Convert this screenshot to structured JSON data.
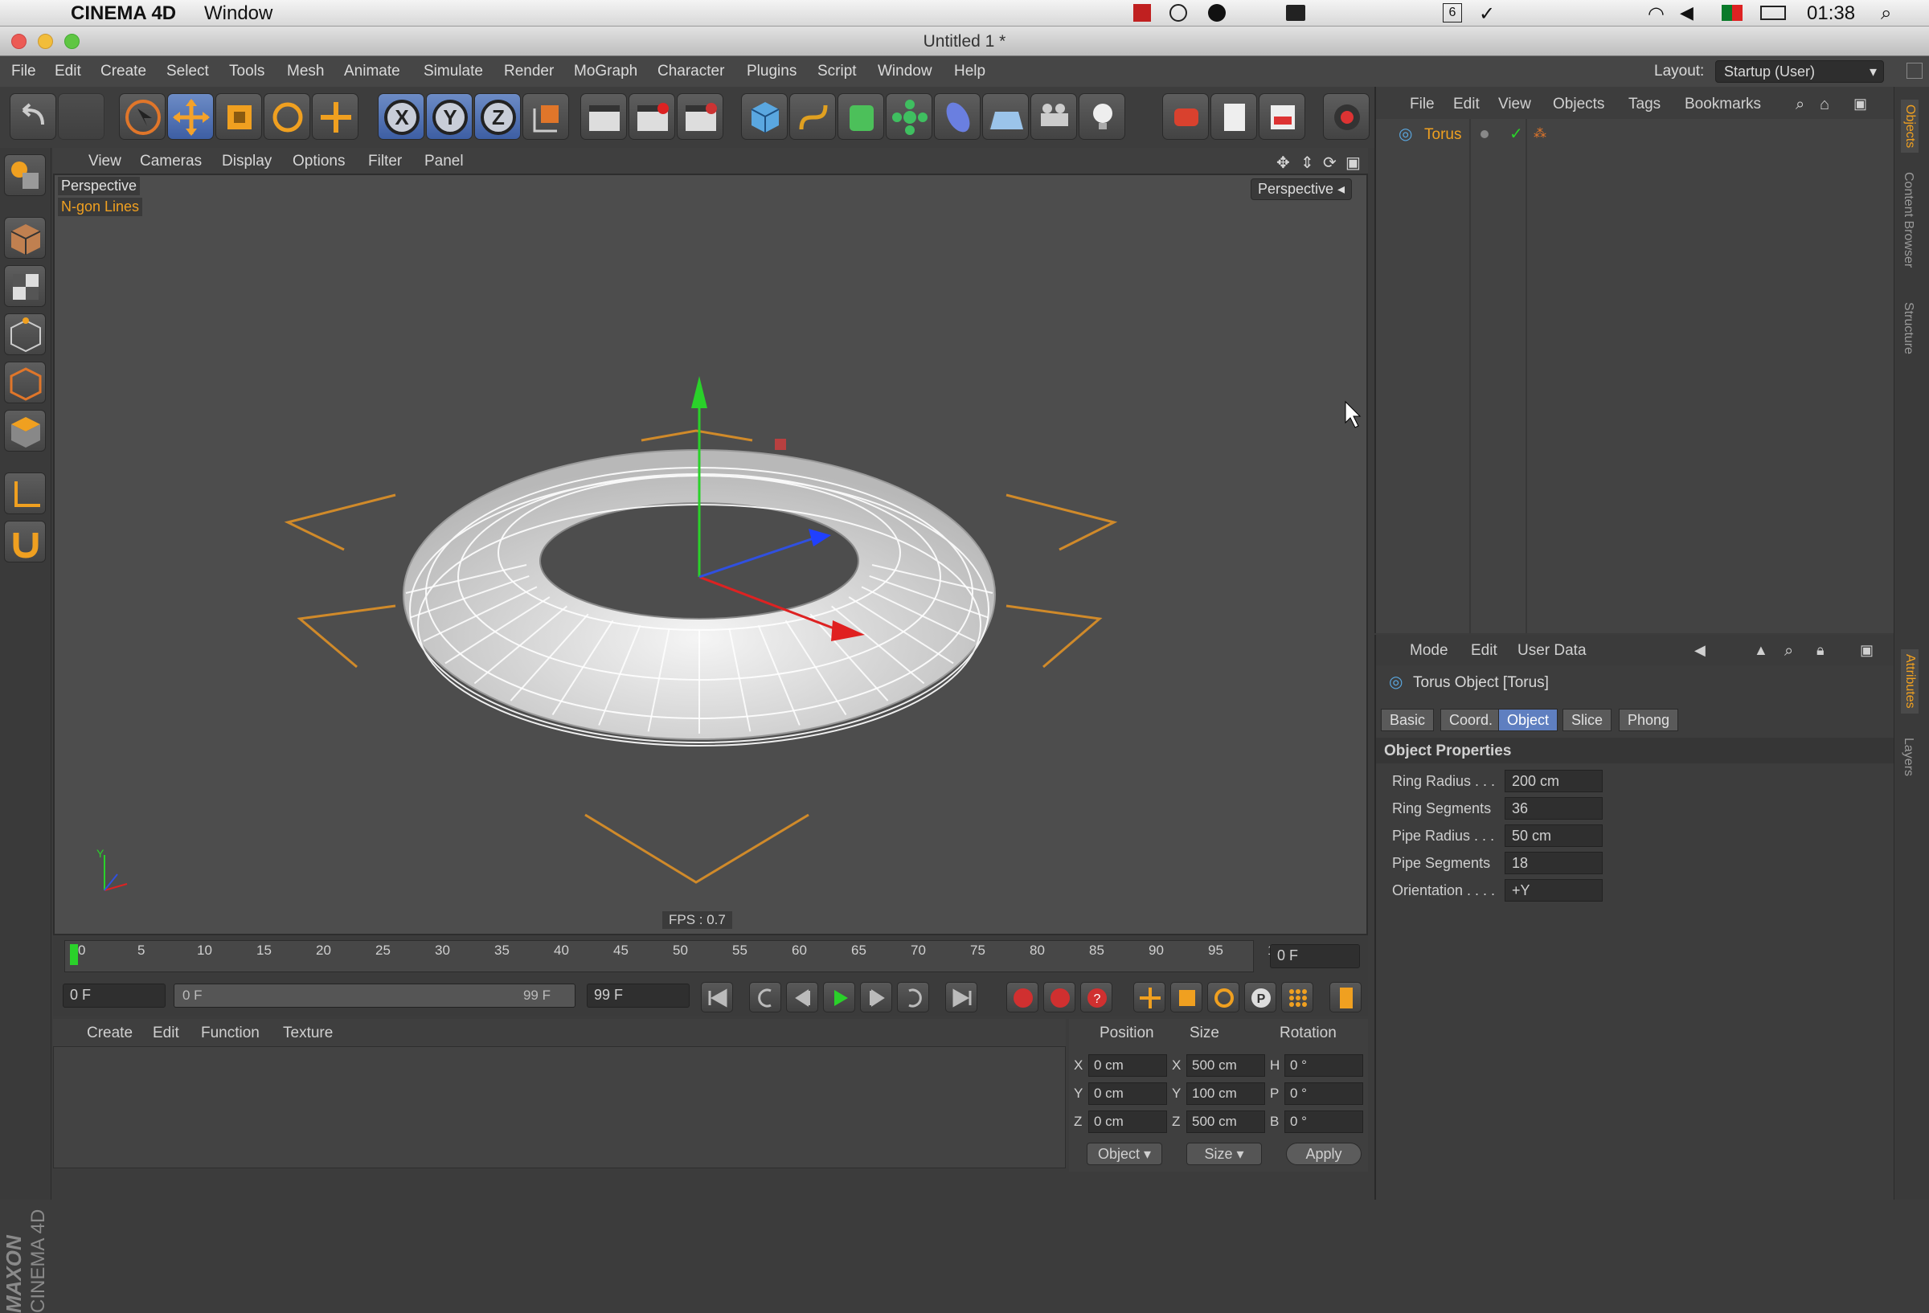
{
  "macbar": {
    "app": "CINEMA 4D",
    "window_menu": "Window",
    "time": "01:38",
    "badge": "6"
  },
  "window": {
    "title": "Untitled 1 *"
  },
  "menu": [
    "File",
    "Edit",
    "Create",
    "Select",
    "Tools",
    "Mesh",
    "Animate",
    "Simulate",
    "Render",
    "MoGraph",
    "Character",
    "Plugins",
    "Script",
    "Window",
    "Help"
  ],
  "layout": {
    "label": "Layout:",
    "value": "Startup (User)"
  },
  "toolbar": {
    "icons": [
      "undo-icon",
      "redo-icon",
      "live-select-icon",
      "move-icon",
      "scale-icon",
      "rotate-icon",
      "add-icon",
      "x-axis-icon",
      "y-axis-icon",
      "z-axis-icon",
      "coord-system-icon",
      "render-view-icon",
      "render-picture-viewer-icon",
      "render-settings-icon",
      "cube-icon",
      "spline-icon",
      "nurbs-icon",
      "array-icon",
      "deformer-icon",
      "scene-icon",
      "camera-icon",
      "light-icon"
    ]
  },
  "viewport": {
    "menu": [
      "View",
      "Cameras",
      "Display",
      "Options",
      "Filter",
      "Panel"
    ],
    "label": "Perspective",
    "sublabel": "N-gon Lines",
    "camera_dropdown": "Perspective",
    "fps": "FPS : 0.7",
    "axis_y": "Y",
    "axis_x": "X",
    "axis_z": "Z"
  },
  "timeline": {
    "ticks": [
      "0",
      "5",
      "10",
      "15",
      "20",
      "25",
      "30",
      "35",
      "40",
      "45",
      "50",
      "55",
      "60",
      "65",
      "70",
      "75",
      "80",
      "85",
      "90",
      "95",
      "1"
    ],
    "current": "0 F",
    "start": "0 F",
    "range_start": "0 F",
    "range_end": "99 F",
    "end": "99 F"
  },
  "material": {
    "menu": [
      "Create",
      "Edit",
      "Function",
      "Texture"
    ]
  },
  "coords": {
    "headers": [
      "Position",
      "Size",
      "Rotation"
    ],
    "rows": [
      {
        "axis": "X",
        "pos": "0 cm",
        "saxis": "X",
        "size": "500 cm",
        "raxis": "H",
        "rot": "0 °"
      },
      {
        "axis": "Y",
        "pos": "0 cm",
        "saxis": "Y",
        "size": "100 cm",
        "raxis": "P",
        "rot": "0 °"
      },
      {
        "axis": "Z",
        "pos": "0 cm",
        "saxis": "Z",
        "size": "500 cm",
        "raxis": "B",
        "rot": "0 °"
      }
    ],
    "mode": "Object",
    "size_mode": "Size",
    "apply": "Apply"
  },
  "objects": {
    "menu": [
      "File",
      "Edit",
      "View",
      "Objects",
      "Tags",
      "Bookmarks"
    ],
    "items": [
      {
        "name": "Torus"
      }
    ]
  },
  "attributes": {
    "menu": [
      "Mode",
      "Edit",
      "User Data"
    ],
    "title": "Torus Object [Torus]",
    "tabs": [
      "Basic",
      "Coord.",
      "Object",
      "Slice",
      "Phong"
    ],
    "selected_tab": "Object",
    "section": "Object Properties",
    "props": [
      {
        "label": "Ring Radius . . .",
        "value": "200 cm"
      },
      {
        "label": "Ring Segments",
        "value": "36"
      },
      {
        "label": "Pipe Radius . . .",
        "value": "50 cm"
      },
      {
        "label": "Pipe Segments",
        "value": "18"
      },
      {
        "label": "Orientation . . . .",
        "value": "+Y"
      }
    ]
  },
  "side_tabs": [
    "Objects",
    "Content Browser",
    "Structure",
    "Attributes",
    "Layers"
  ],
  "brand": {
    "line1": "MAXON",
    "line2": "CINEMA 4D"
  }
}
